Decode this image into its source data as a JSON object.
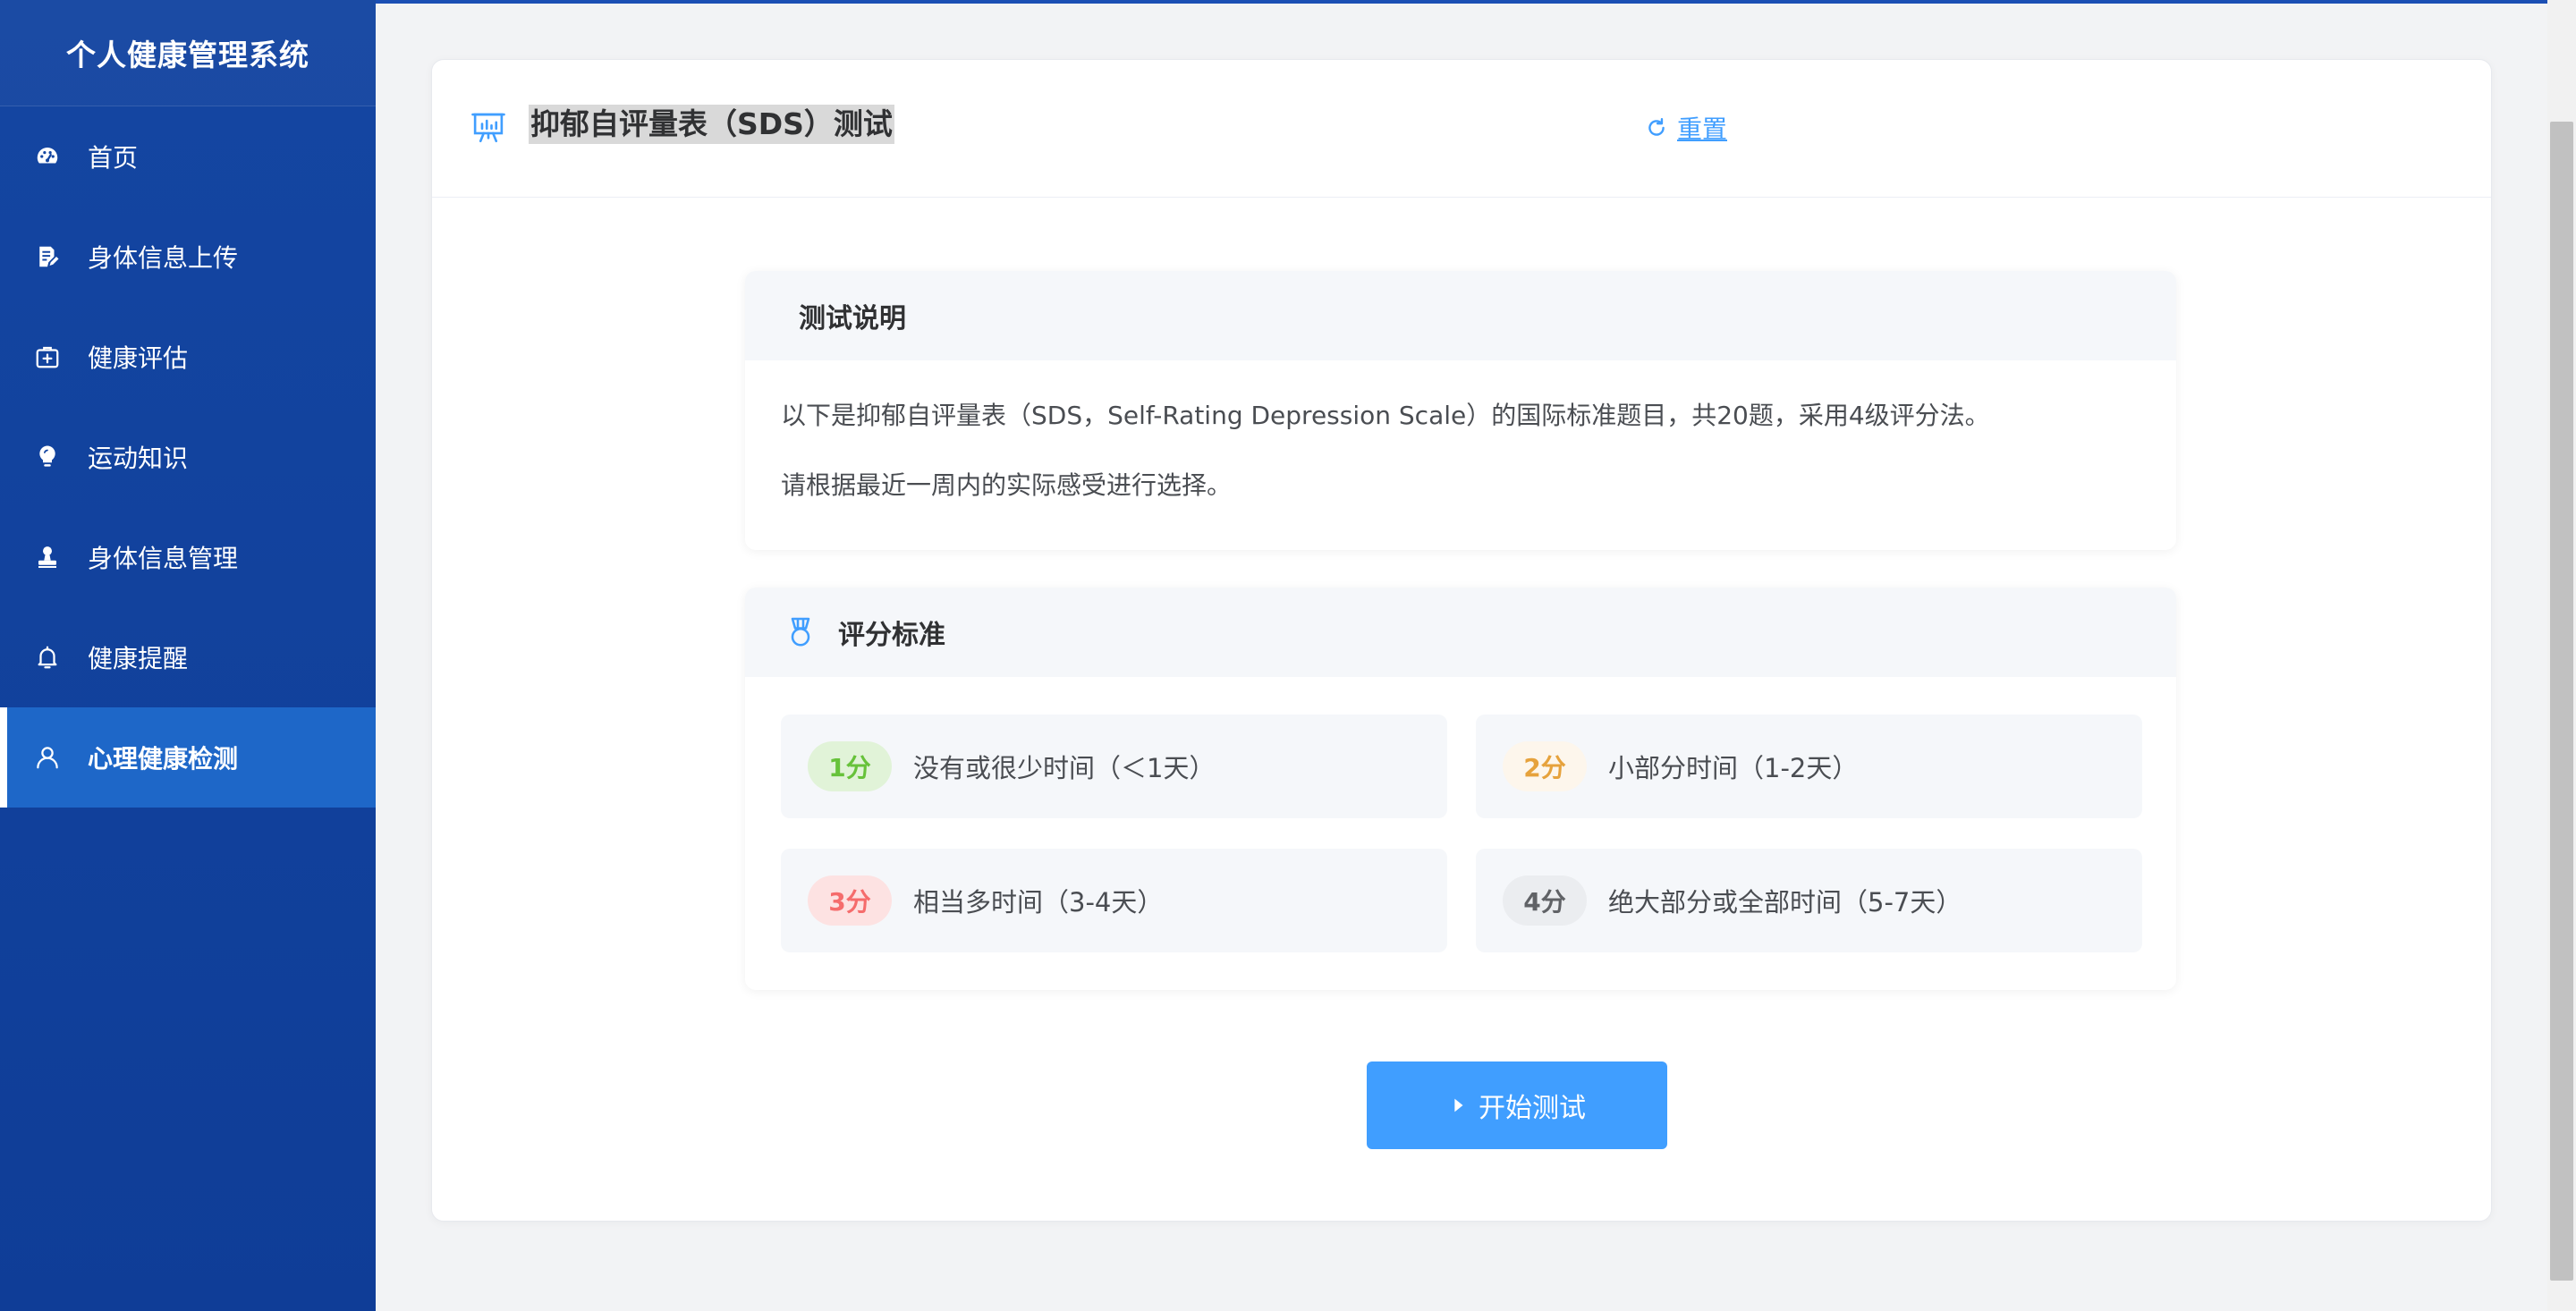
{
  "sidebar": {
    "title": "个人健康管理系统",
    "items": [
      {
        "label": "首页",
        "icon": "dashboard-icon"
      },
      {
        "label": "身体信息上传",
        "icon": "document-edit-icon"
      },
      {
        "label": "健康评估",
        "icon": "medical-box-icon"
      },
      {
        "label": "运动知识",
        "icon": "lightbulb-icon"
      },
      {
        "label": "身体信息管理",
        "icon": "stamp-icon"
      },
      {
        "label": "健康提醒",
        "icon": "bell-icon"
      },
      {
        "label": "心理健康检测",
        "icon": "user-icon",
        "active": true
      }
    ]
  },
  "header": {
    "icon": "presentation-chart-icon",
    "title": "抑郁自评量表（SDS）测试",
    "reset_label": "重置",
    "reset_icon": "refresh-icon"
  },
  "instructions": {
    "title": "测试说明",
    "line1": "以下是抑郁自评量表（SDS，Self-Rating Depression Scale）的国际标准题目，共20题，采用4级评分法。",
    "line2": "请根据最近一周内的实际感受进行选择。"
  },
  "scoring": {
    "title": "评分标准",
    "icon": "medal-icon",
    "items": [
      {
        "score": "1分",
        "text": "没有或很少时间（＜1天）",
        "color": "#67c23a",
        "bg": "#e1f3d8"
      },
      {
        "score": "2分",
        "text": "小部分时间（1-2天）",
        "color": "#e6a23c",
        "bg": "#fdf6ec"
      },
      {
        "score": "3分",
        "text": "相当多时间（3-4天）",
        "color": "#f56c6c",
        "bg": "#fde2e2"
      },
      {
        "score": "4分",
        "text": "绝大部分或全部时间（5-7天）",
        "color": "#606266",
        "bg": "#ebedf0"
      }
    ]
  },
  "start_button": {
    "label": "开始测试",
    "icon": "caret-right-icon"
  },
  "colors": {
    "sidebar_bg": "#1446a2",
    "sidebar_active": "#1e67c8",
    "primary": "#409eff"
  }
}
